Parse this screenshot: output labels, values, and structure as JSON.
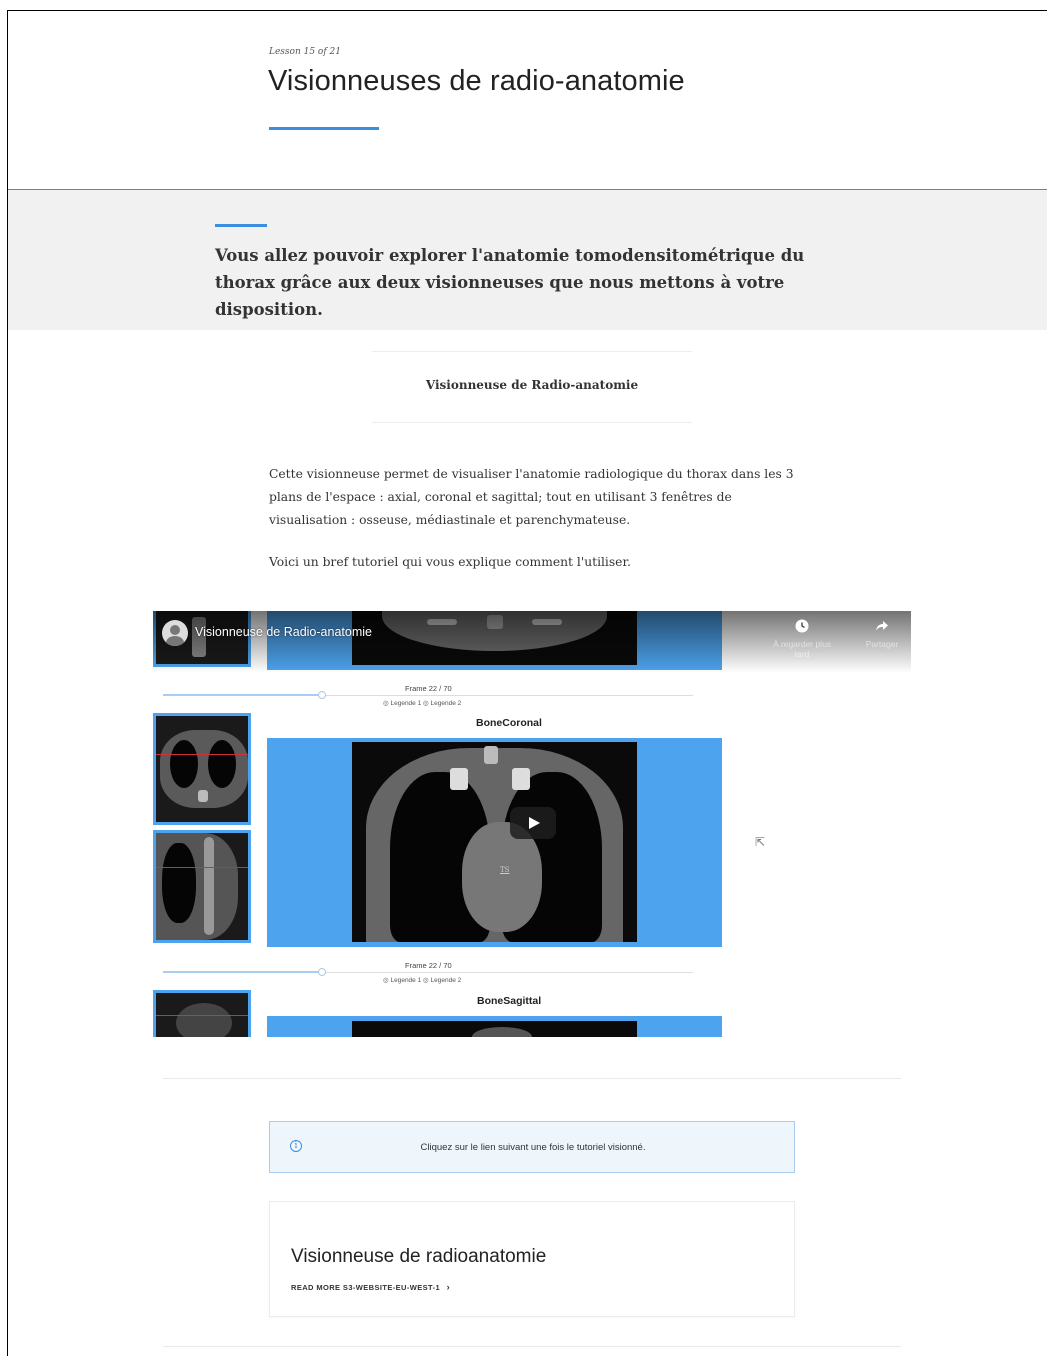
{
  "lesson": {
    "counter": "Lesson 15 of 21",
    "title": "Visionneuses de radio-anatomie"
  },
  "intro": {
    "text": "Vous allez pouvoir explorer l'anatomie tomodensitométrique du thorax grâce aux deux visionneuses que nous mettons à votre disposition."
  },
  "viewer": {
    "heading": "Visionneuse de Radio-anatomie",
    "description": "Cette visionneuse permet de visualiser l'anatomie radiologique du thorax dans les 3 plans de l'espace : axial, coronal et sagittal; tout en utilisant 3 fenêtres de visualisation : osseuse, médiastinale et parenchymateuse.",
    "tutorial_note": "Voici un bref tutoriel qui vous explique comment l'utiliser."
  },
  "video": {
    "title": "Visionneuse de Radio-anatomie",
    "watch_later_label": "À regarder plus tard",
    "share_label": "Partager",
    "frame_label_1": "Frame 22 / 70",
    "legend_1": "Legende 1",
    "legend_2": "Legende 2",
    "panel_coronal": "BoneCoronal",
    "frame_label_2": "Frame 22 / 70",
    "legend_3": "Legende 1",
    "legend_4": "Legende 2",
    "panel_sagittal": "BoneSagittal",
    "scan_marker": "TS",
    "slider_progress": 0.3
  },
  "notice": {
    "text": "Cliquez sur le lien suivant une fois le tutoriel visionné."
  },
  "card": {
    "title": "Visionneuse de radioanatomie",
    "link": "READ MORE S3-WEBSITE-EU-WEST-1"
  },
  "colors": {
    "accent": "#3b8ee0",
    "viewer_blue": "#4da3ee"
  }
}
